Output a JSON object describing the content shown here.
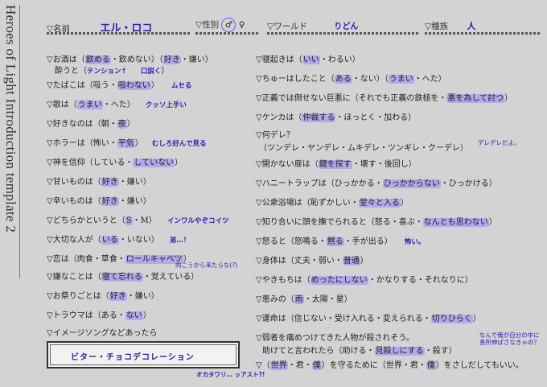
{
  "title": "Heroes of Light Introduction template 2",
  "header": {
    "name_label": "▽名前",
    "name_value": "エル・ロコ",
    "gender_label": "▽性別",
    "gender_male": "♂",
    "gender_female": "♀",
    "world_label": "▽ワールド",
    "world_value": "りどん",
    "race_label": "▽種族",
    "race_value": "人"
  },
  "left": {
    "q1a": "▽お酒は（",
    "q1b": "飲める",
    "q1c": "・飲めない）（",
    "q1d": "好き",
    "q1e": "・嫌い）",
    "q1f": "酔うと（",
    "q1g": "テンション↑",
    "q1h": "口説く",
    "q1i": "）",
    "q2a": "▽たばこは（吸う・",
    "q2b": "吸わない",
    "q2c": "）",
    "q2n": "ムセる",
    "q3a": "▽歌は（",
    "q3b": "うまい",
    "q3c": "・へた）",
    "q3n": "クッソ上手い",
    "q4a": "▽好きなのは（朝・",
    "q4b": "夜",
    "q4c": "）",
    "q5a": "▽ホラーは（怖い・",
    "q5b": "平気",
    "q5c": "）",
    "q5n": "むしろ好んで見る",
    "q6a": "▽神を信仰（している・",
    "q6b": "していない",
    "q6c": "）",
    "q7a": "▽甘いものは（",
    "q7b": "好き",
    "q7c": "・嫌い）",
    "q8a": "▽辛いものは（",
    "q8b": "好き",
    "q8c": "・嫌い）",
    "q9a": "▽どちらかというと（",
    "q9b": "S",
    "q9c": "・M）",
    "q9n": "インワルやぞコイツ",
    "q10a": "▽大切な人が（",
    "q10b": "いる",
    "q10c": "・いない）",
    "q10n": "弟…！",
    "q11a": "▽恋は（肉食・草食・",
    "q11b": "ロールキャベツ",
    "q11c": "）",
    "q11n": "向こうから来たらな(?)",
    "q12a": "▽嫌なことは（",
    "q12b": "寝て忘れる",
    "q12c": "・覚えている）",
    "q13a": "▽お祭りごとは（",
    "q13b": "好き",
    "q13c": "・嫌い）",
    "q14a": "▽トラウマは（ある・",
    "q14b": "ない",
    "q14c": "）",
    "q15": "▽イメージソングなどあったら",
    "song": "ビター・チョコデコレーション",
    "song_note": "オカタワリ… ッアスト?!"
  },
  "right": {
    "r1a": "▽寝起きは（",
    "r1b": "いい",
    "r1c": "・わるい）",
    "r2a": "▽ちゅーはしたこと（",
    "r2b": "ある",
    "r2c": "・ない）（",
    "r2d": "うまい",
    "r2e": "・へた）",
    "r3a": "▽正義では倒せない巨悪に（それでも正義の鉄槌を・",
    "r3b": "悪を為して討つ",
    "r3c": "）",
    "r4a": "▽ケンカは（",
    "r4b": "仲裁する",
    "r4c": "・ほっとく・加わる）",
    "r5a": "▽何デレ？",
    "r5b": "（ツンデレ・ヤンデレ・ムキデレ・ツンギレ・クーデレ）",
    "r5n": "デレデレだよ。",
    "r6a": "▽開かない扉は（",
    "r6b": "鍵を探す",
    "r6c": "・壊す・後回し）",
    "r7a": "▽ハニートラップは（ひっかかる・",
    "r7b": "ひっかからない",
    "r7c": "・ひっかける）",
    "r8a": "▽公衆浴場は（恥ずかしい・",
    "r8b": "堂々と入る",
    "r8c": "）",
    "r9a": "▽知り合いに頭を撫でられると（怒る・喜ぶ・",
    "r9b": "なんとも思わない",
    "r9c": "）",
    "r10a": "▽怒ると（怒鳴る・",
    "r10b": "黙る",
    "r10c": "・手が出る）",
    "r10n": "怖い。",
    "r11a": "▽身体は（丈夫・弱い・",
    "r11b": "普通",
    "r11c": "）",
    "r12a": "▽やきもちは（",
    "r12b": "めったにしない",
    "r12c": "・かなりする・それなりに）",
    "r13a": "▽恵みの（",
    "r13b": "雨",
    "r13c": "・太陽・星）",
    "r14a": "▽運命は（信じない・受け入れる・変えられる・",
    "r14b": "切りひらく",
    "r14c": "）",
    "r15a": "▽弱者を痛めつけてきた人物が殺されそう。",
    "r15b": "助けてと言われたら（助ける・",
    "r15c": "見殺しにする",
    "r15d": "・殺す）",
    "r15n1": "なんで俺が自分の中に",
    "r15n2": "長所伸ばさなきゃの？",
    "r16a": "▽（",
    "r16b": "世界",
    "r16c": "・君・",
    "r16d": "僕",
    "r16e": "）を守るために（世界・君・",
    "r16f": "僕",
    "r16g": "）をさしだしてもいい。"
  }
}
